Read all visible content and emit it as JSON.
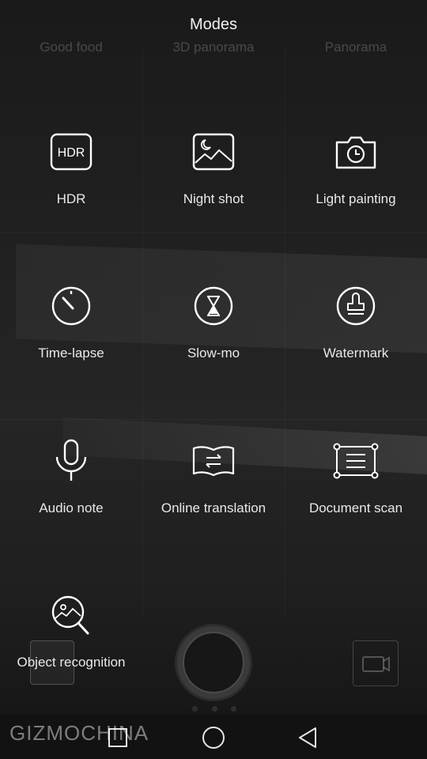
{
  "header": {
    "title": "Modes",
    "ghost_row": [
      "Good food",
      "3D panorama",
      "Panorama"
    ]
  },
  "modes": [
    {
      "label": "HDR",
      "icon": "hdr-icon",
      "icon_text": "HDR"
    },
    {
      "label": "Night shot",
      "icon": "night-shot-icon"
    },
    {
      "label": "Light painting",
      "icon": "light-painting-icon"
    },
    {
      "label": "Time-lapse",
      "icon": "time-lapse-icon"
    },
    {
      "label": "Slow-mo",
      "icon": "slow-mo-icon"
    },
    {
      "label": "Watermark",
      "icon": "watermark-icon"
    },
    {
      "label": "Audio note",
      "icon": "audio-note-icon"
    },
    {
      "label": "Online translation",
      "icon": "online-translation-icon"
    },
    {
      "label": "Document scan",
      "icon": "document-scan-icon"
    },
    {
      "label": "Object recognition",
      "icon": "object-recognition-icon"
    }
  ],
  "watermark": "GIZMOCHINA",
  "colors": {
    "background": "#1d1d1d",
    "text": "#e9e9e9",
    "icon": "#ffffff"
  }
}
